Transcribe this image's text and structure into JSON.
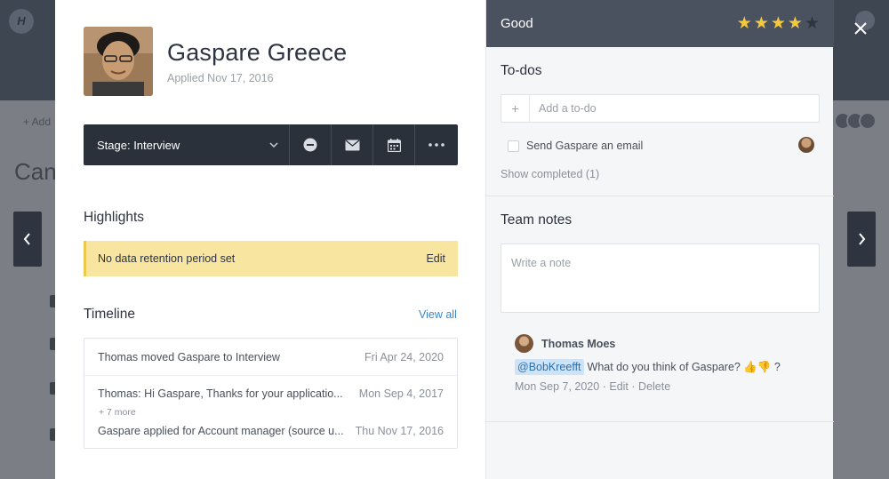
{
  "background": {
    "logo_letter": "H",
    "add_text": "+ Add",
    "title_text": "Can"
  },
  "candidate": {
    "name": "Gaspare Greece",
    "applied": "Applied Nov 17, 2016"
  },
  "stage": {
    "label": "Stage: Interview",
    "actions": [
      "reject-icon",
      "email-icon",
      "calendar-icon",
      "more-icon"
    ]
  },
  "highlights": {
    "title": "Highlights",
    "notice": "No data retention period set",
    "edit_label": "Edit"
  },
  "timeline": {
    "title": "Timeline",
    "view_all": "View all",
    "items": [
      {
        "text": "Thomas moved Gaspare to Interview",
        "date": "Fri Apr 24, 2020"
      },
      {
        "text": "Thomas: Hi Gaspare, Thanks for your applicatio...",
        "date": "Mon Sep 4, 2017"
      },
      {
        "text": "Gaspare applied for Account manager (source u...",
        "date": "Thu Nov 17, 2016"
      }
    ],
    "more": "+ 7 more"
  },
  "rating": {
    "label": "Good",
    "value": 4,
    "max": 5,
    "star_color": "#f5c842",
    "empty_star_color": "#2f3540"
  },
  "todos": {
    "title": "To-dos",
    "placeholder": "Add a to-do",
    "items": [
      {
        "text": "Send Gaspare an email",
        "done": false
      }
    ],
    "show_completed": "Show completed (1)"
  },
  "team_notes": {
    "title": "Team notes",
    "placeholder": "Write a note",
    "note": {
      "author": "Thomas Moes",
      "mention": "@BobKreefft",
      "text": "What do you think of Gaspare? 👍👎 ?",
      "date": "Mon Sep 7, 2020",
      "edit": "Edit",
      "delete": "Delete",
      "sep": "·"
    }
  },
  "colors": {
    "accent_link": "#3d85c6",
    "stage_bar": "#2b313b",
    "highlight_bg": "#f8e6a0",
    "rating_bar": "#4a5260"
  }
}
